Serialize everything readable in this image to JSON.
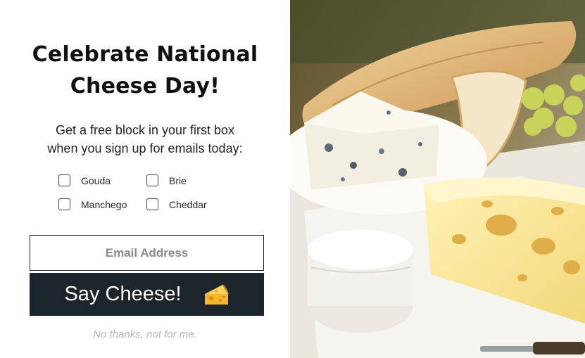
{
  "popup": {
    "title_line1": "Celebrate National",
    "title_line2": "Cheese Day!",
    "subtitle_line1": "Get a free block in your first box",
    "subtitle_line2": "when you sign up for emails today:",
    "options": [
      {
        "label": "Gouda",
        "checked": false
      },
      {
        "label": "Brie",
        "checked": false
      },
      {
        "label": "Manchego",
        "checked": false
      },
      {
        "label": "Cheddar",
        "checked": false
      }
    ],
    "email_placeholder": "Email Address",
    "cta_label": "Say Cheese!",
    "cta_icon": "cheese-wedge-icon",
    "decline_label": "No thanks, not for me."
  },
  "colors": {
    "cta_background": "#1c252b",
    "cta_text": "#ffffff",
    "decline_text": "#b5b5b5",
    "cheese_icon": "#f5b52a"
  },
  "image": {
    "subject": "cheese-board-photo"
  }
}
